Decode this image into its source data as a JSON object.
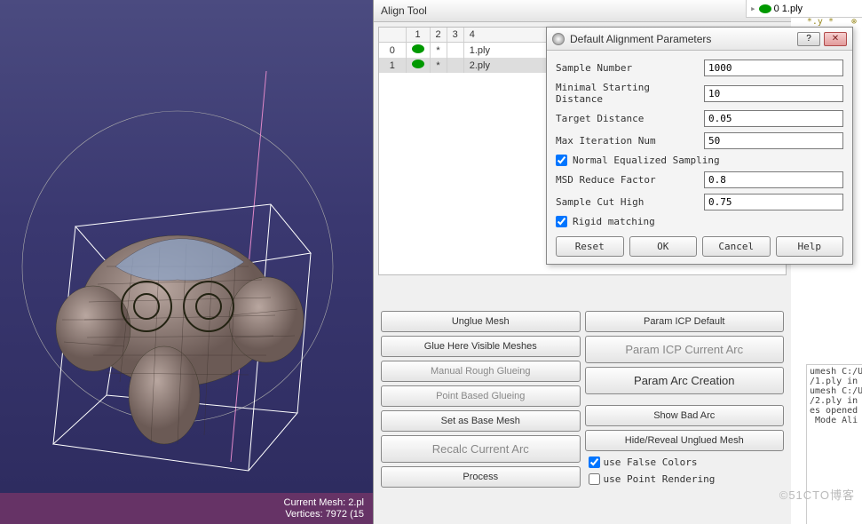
{
  "align_panel": {
    "title": "Align Tool",
    "headers": [
      "",
      "1",
      "2",
      "3",
      "4"
    ],
    "rows": [
      {
        "idx": "0",
        "star": "*",
        "name": "1.ply",
        "selected": false
      },
      {
        "idx": "1",
        "star": "*",
        "name": "2.ply",
        "selected": true
      }
    ],
    "left_buttons": {
      "unglue": "Unglue Mesh",
      "glue_here": "Glue Here Visible Meshes",
      "manual": "Manual Rough Glueing",
      "point_based": "Point Based Glueing",
      "set_base": "Set as Base Mesh",
      "recalc": "Recalc Current Arc",
      "process": "Process"
    },
    "right_buttons": {
      "param_icp_default": "Param ICP Default",
      "param_icp_current": "Param ICP Current Arc",
      "param_arc_creation": "Param Arc Creation",
      "show_bad": "Show Bad Arc",
      "hide_reveal": "Hide/Reveal Unglued Mesh"
    },
    "checks": {
      "false_colors": {
        "label": "use False Colors",
        "checked": true
      },
      "point_render": {
        "label": "use Point Rendering",
        "checked": false
      }
    }
  },
  "dialog": {
    "title": "Default Alignment Parameters",
    "fields": {
      "sample_number": {
        "label": "Sample Number",
        "value": "1000"
      },
      "min_start_dist": {
        "label": "Minimal Starting Distance",
        "value": "10"
      },
      "target_distance": {
        "label": "Target Distance",
        "value": "0.05"
      },
      "max_iter": {
        "label": "Max Iteration Num",
        "value": "50"
      },
      "normal_eq": {
        "label": "Normal Equalized Sampling",
        "checked": true
      },
      "msd_reduce": {
        "label": "MSD Reduce Factor",
        "value": "0.8"
      },
      "sample_cut": {
        "label": "Sample Cut High",
        "value": "0.75"
      },
      "rigid": {
        "label": "Rigid matching",
        "checked": true
      }
    },
    "buttons": {
      "reset": "Reset",
      "ok": "OK",
      "cancel": "Cancel",
      "help": "Help"
    }
  },
  "top_right": {
    "label": "0 1.ply"
  },
  "side_log": "umesh C:/U:\n/1.ply in\numesh C:/U:\n/2.ply in\nes opened \n Mode Ali",
  "status": {
    "current_mesh": "Current Mesh: 2.pl",
    "vertices": "Vertices: 7972 (15"
  },
  "pin": {
    "a": "*.y *",
    "b": "⊗"
  },
  "watermark": "©51CTO博客"
}
